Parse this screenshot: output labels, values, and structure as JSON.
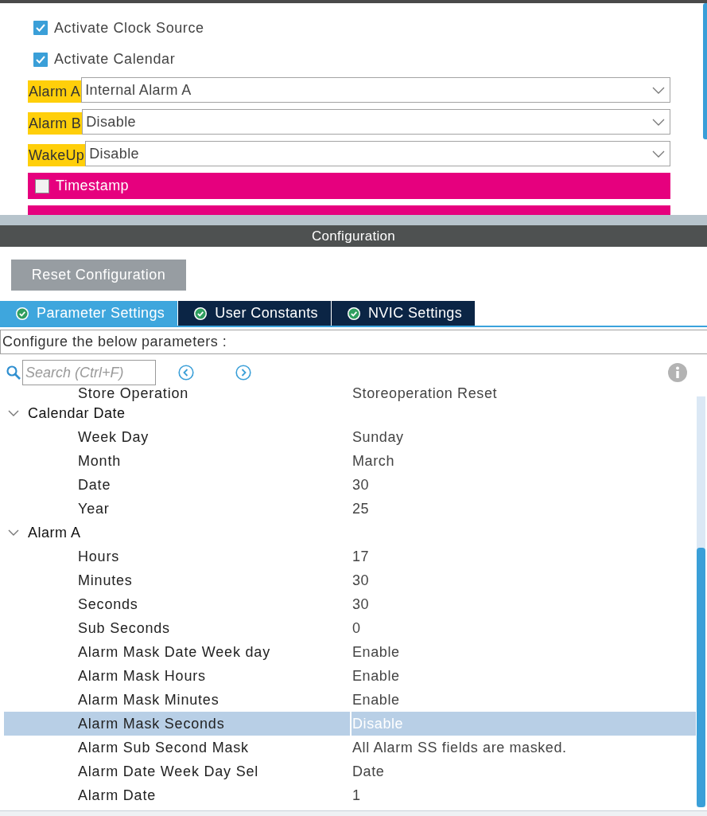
{
  "top_panel": {
    "checkboxes": [
      {
        "label": "Activate Clock Source",
        "checked": true
      },
      {
        "label": "Activate Calendar",
        "checked": true
      }
    ],
    "selects": [
      {
        "label": "Alarm A",
        "value": "Internal Alarm A"
      },
      {
        "label": "Alarm B",
        "value": "Disable"
      },
      {
        "label": "WakeUp",
        "value": "Disable"
      }
    ],
    "options": [
      {
        "label": "Timestamp",
        "checked": false
      }
    ]
  },
  "configuration": {
    "title": "Configuration",
    "reset_button": "Reset Configuration",
    "tabs": [
      {
        "label": "Parameter Settings",
        "selected": true
      },
      {
        "label": "User Constants",
        "selected": false
      },
      {
        "label": "NVIC Settings",
        "selected": false
      }
    ],
    "description": "Configure the below parameters :",
    "search": {
      "placeholder": "Search (Ctrl+F)"
    },
    "parameters": [
      {
        "kind": "param",
        "label": "Store Operation",
        "value": "Storeoperation Reset",
        "selected": false
      },
      {
        "kind": "group",
        "label": "Calendar Date",
        "expanded": true,
        "children": [
          {
            "kind": "param",
            "label": "Week Day",
            "value": "Sunday",
            "selected": false
          },
          {
            "kind": "param",
            "label": "Month",
            "value": "March",
            "selected": false
          },
          {
            "kind": "param",
            "label": "Date",
            "value": "30",
            "selected": false
          },
          {
            "kind": "param",
            "label": "Year",
            "value": "25",
            "selected": false
          }
        ]
      },
      {
        "kind": "group",
        "label": "Alarm A",
        "expanded": true,
        "children": [
          {
            "kind": "param",
            "label": "Hours",
            "value": "17",
            "selected": false
          },
          {
            "kind": "param",
            "label": "Minutes",
            "value": "30",
            "selected": false
          },
          {
            "kind": "param",
            "label": "Seconds",
            "value": "30",
            "selected": false
          },
          {
            "kind": "param",
            "label": "Sub Seconds",
            "value": "0",
            "selected": false
          },
          {
            "kind": "param",
            "label": "Alarm Mask Date Week day",
            "value": "Enable",
            "selected": false
          },
          {
            "kind": "param",
            "label": "Alarm Mask Hours",
            "value": "Enable",
            "selected": false
          },
          {
            "kind": "param",
            "label": "Alarm Mask Minutes",
            "value": "Enable",
            "selected": false
          },
          {
            "kind": "param",
            "label": "Alarm Mask Seconds",
            "value": "Disable",
            "selected": true
          },
          {
            "kind": "param",
            "label": "Alarm Sub Second Mask",
            "value": "All Alarm SS fields are masked.",
            "selected": false
          },
          {
            "kind": "param",
            "label": "Alarm Date Week Day Sel",
            "value": "Date",
            "selected": false
          },
          {
            "kind": "param",
            "label": "Alarm Date",
            "value": "1",
            "selected": false
          }
        ]
      }
    ]
  }
}
